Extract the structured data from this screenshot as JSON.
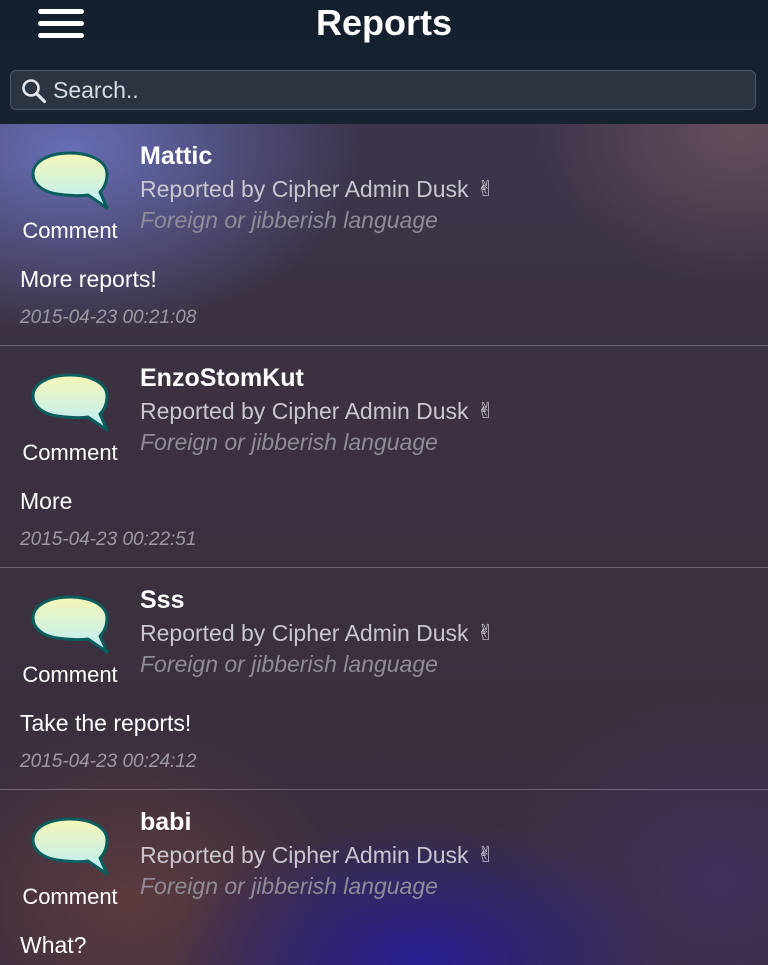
{
  "header": {
    "title": "Reports",
    "menu_icon": "hamburger-menu-icon"
  },
  "search": {
    "placeholder": "Search..",
    "value": "",
    "icon": "search-icon"
  },
  "reports": [
    {
      "name": "Mattic",
      "type_label": "Comment",
      "reporter": "Reported by Cipher Admin Dusk",
      "reporter_icon": "✌",
      "reason": "Foreign or jibberish language",
      "message": "More reports!",
      "timestamp": "2015-04-23 00:21:08"
    },
    {
      "name": "EnzoStomKut",
      "type_label": "Comment",
      "reporter": "Reported by Cipher Admin Dusk",
      "reporter_icon": "✌",
      "reason": "Foreign or jibberish language",
      "message": "More",
      "timestamp": "2015-04-23 00:22:51"
    },
    {
      "name": "Sss",
      "type_label": "Comment",
      "reporter": "Reported by Cipher Admin Dusk",
      "reporter_icon": "✌",
      "reason": "Foreign or jibberish language",
      "message": "Take the reports!",
      "timestamp": "2015-04-23 00:24:12"
    },
    {
      "name": "babi",
      "type_label": "Comment",
      "reporter": "Reported by Cipher Admin Dusk",
      "reporter_icon": "✌",
      "reason": "Foreign or jibberish language",
      "message": "What?",
      "timestamp": ""
    }
  ],
  "colors": {
    "header_bg": "#13202e",
    "search_bg": "#2b3440",
    "bubble_top": "#f7f6b6",
    "bubble_bottom": "#bff0f7",
    "bubble_outline": "#0b5d5d"
  }
}
